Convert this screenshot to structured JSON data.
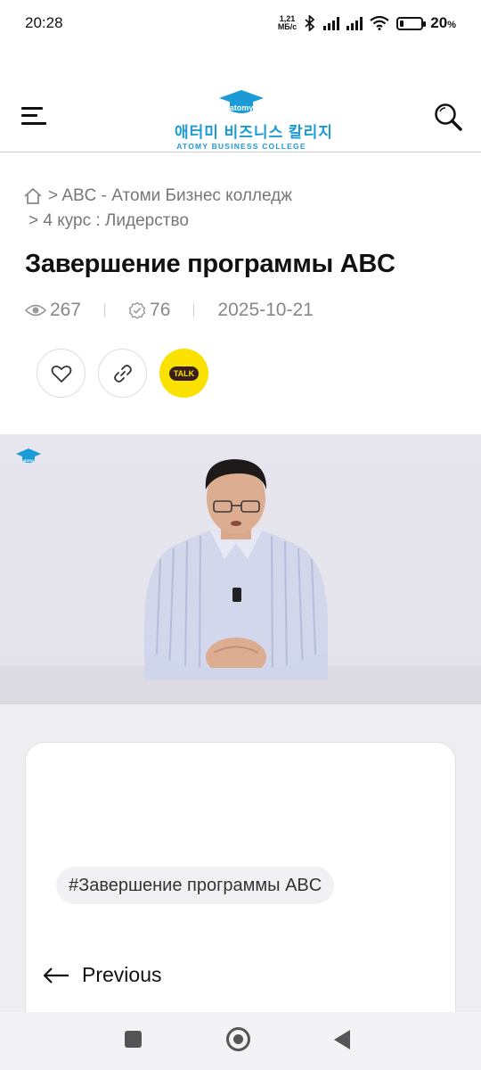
{
  "status_bar": {
    "time": "20:28",
    "net_speed_value": "1,21",
    "net_speed_unit": "МБ/с",
    "battery": "20",
    "battery_unit": "%",
    "battery_level": 0.2
  },
  "header": {
    "logo_badge": "atomy",
    "logo_korean": "애터미 비즈니스 칼리지",
    "logo_english": "ATOMY BUSINESS COLLEGE"
  },
  "breadcrumb": {
    "level1": "> ABC - Атоми Бизнес колледж",
    "level2": "> 4 курс : Лидерство"
  },
  "article": {
    "title": "Завершение программы ABC",
    "views": "267",
    "completions": "76",
    "date": "2025-10-21"
  },
  "actions": {
    "kakao_label": "TALK"
  },
  "video": {
    "watermark_text": "atomy"
  },
  "tags": [
    "#Завершение программы ABC"
  ],
  "navigation": {
    "previous_label": "Previous"
  },
  "colors": {
    "brand_blue": "#1a9bd7",
    "kakao_yellow": "#fae100",
    "content_bg": "#eeeef1"
  }
}
